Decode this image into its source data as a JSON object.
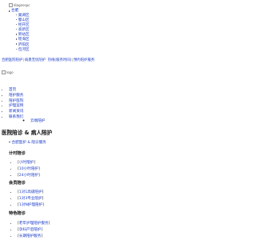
{
  "header": {
    "logo_top_alt": "diagnospc",
    "current_location": "合肥",
    "locations": [
      "巢湖区",
      "蜀山区",
      "经开区",
      "高新区",
      "新站区",
      "瑶海区",
      "庐阳区",
      "包河区"
    ]
  },
  "topbar": {
    "link1": "合肥医院陪护",
    "link2": "病患无忧陪护",
    "text": "热线(服务时间)",
    "link3": "预约陪护服务"
  },
  "logo_alt": "logo",
  "nav": {
    "items": [
      "首页",
      "陪护服务",
      "陪护医院",
      "护理案例",
      "新闻资讯",
      "联系我们"
    ],
    "sub_items": [
      "云端陪护"
    ]
  },
  "page": {
    "title": "医院陪诊 & 病人陪护",
    "breadcrumb": "合肥医护 & 陪诊服务"
  },
  "sections": [
    {
      "title": "计时陪诊",
      "items": [
        "小时陪护",
        "10小时陪护",
        "24小时陪护"
      ]
    },
    {
      "title": "会员陪诊",
      "items": [
        "1对1高级陪护",
        "1对3专业陪护",
        "1对N护理陪护"
      ]
    },
    {
      "title": "特色陪诊",
      "items": [
        "老年护理陪护服务",
        "孕妇产后陪护",
        "长期陪护服务"
      ]
    }
  ]
}
